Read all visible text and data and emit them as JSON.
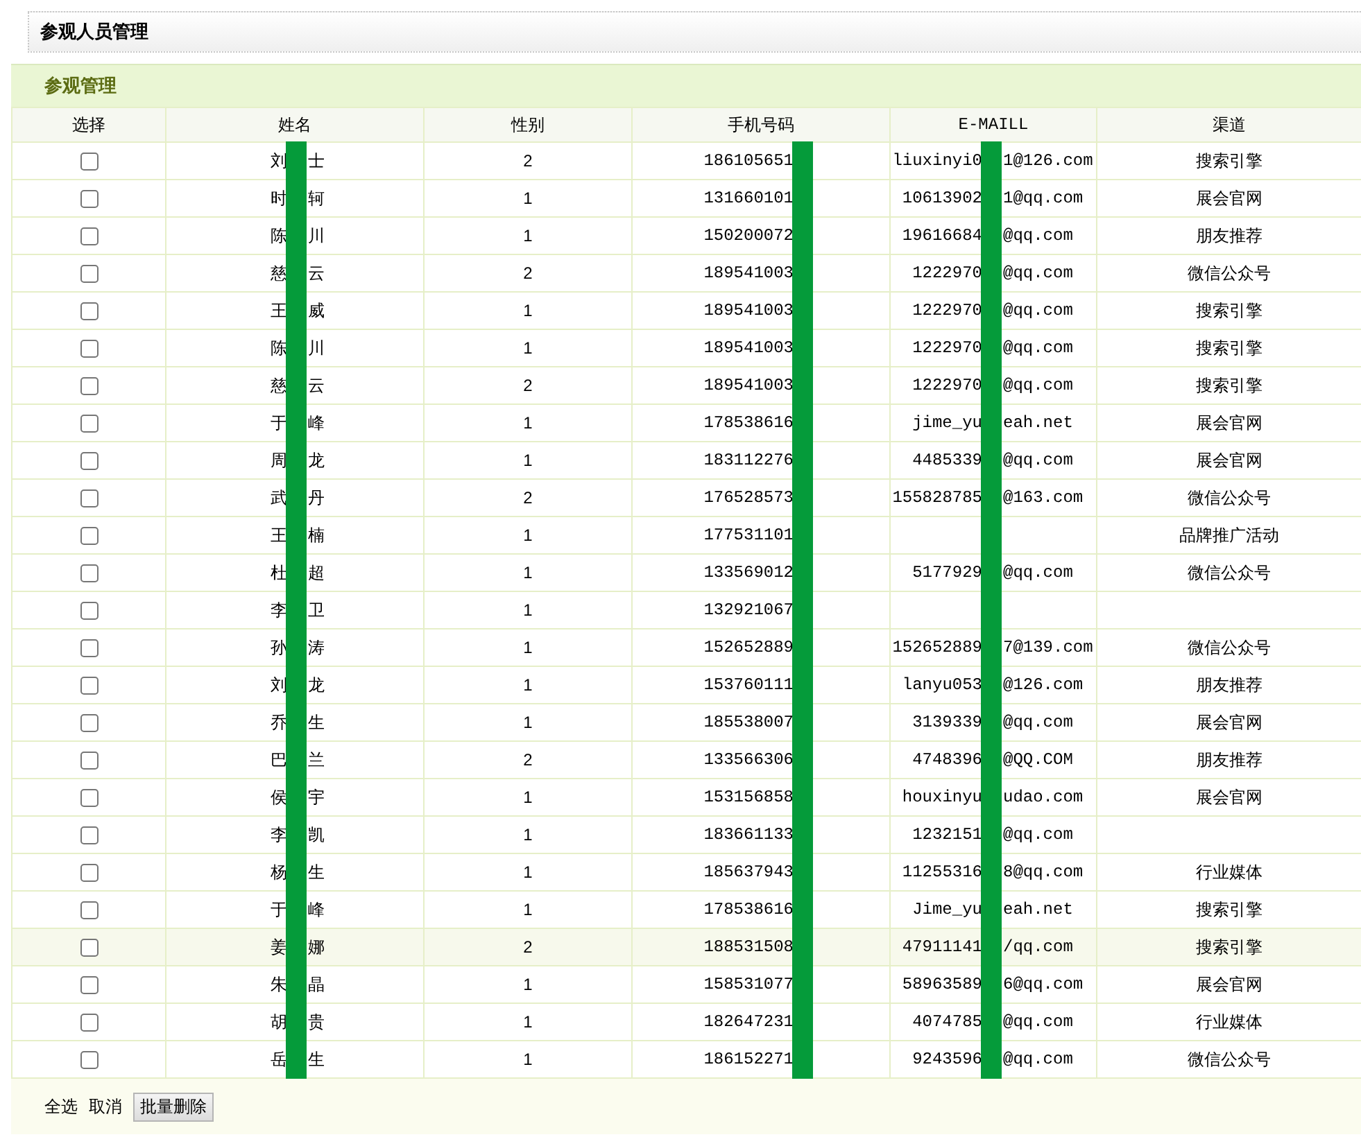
{
  "page_title": "参观人员管理",
  "panel": {
    "title": "参观管理",
    "columns": [
      "选择",
      "姓名",
      "性别",
      "手机号码",
      "E-MAILL",
      "渠道"
    ],
    "rows": [
      {
        "checked": false,
        "hovered": false,
        "name_start": "刘",
        "name_end": "士",
        "gender": "2",
        "phone": "186105651",
        "email_start": "liuxinyi0",
        "email_end": "1@126.com",
        "channel": "搜索引擎"
      },
      {
        "checked": false,
        "hovered": false,
        "name_start": "时",
        "name_end": "轲",
        "gender": "1",
        "phone": "131660101",
        "email_start": "10613902",
        "email_end": "1@qq.com",
        "channel": "展会官网"
      },
      {
        "checked": false,
        "hovered": false,
        "name_start": "陈",
        "name_end": "川",
        "gender": "1",
        "phone": "150200072",
        "email_start": "19616684",
        "email_end": "@qq.com",
        "channel": "朋友推荐"
      },
      {
        "checked": false,
        "hovered": false,
        "name_start": "慈",
        "name_end": "云",
        "gender": "2",
        "phone": "189541003",
        "email_start": "1222970",
        "email_end": "@qq.com",
        "channel": "微信公众号"
      },
      {
        "checked": false,
        "hovered": false,
        "name_start": "王",
        "name_end": "威",
        "gender": "1",
        "phone": "189541003",
        "email_start": "1222970",
        "email_end": "@qq.com",
        "channel": "搜索引擎"
      },
      {
        "checked": false,
        "hovered": false,
        "name_start": "陈",
        "name_end": "川",
        "gender": "1",
        "phone": "189541003",
        "email_start": "1222970",
        "email_end": "@qq.com",
        "channel": "搜索引擎"
      },
      {
        "checked": false,
        "hovered": false,
        "name_start": "慈",
        "name_end": "云",
        "gender": "2",
        "phone": "189541003",
        "email_start": "1222970",
        "email_end": "@qq.com",
        "channel": "搜索引擎"
      },
      {
        "checked": false,
        "hovered": false,
        "name_start": "于",
        "name_end": "峰",
        "gender": "1",
        "phone": "178538616",
        "email_start": "jime_yu",
        "email_end": "eah.net",
        "channel": "展会官网"
      },
      {
        "checked": false,
        "hovered": false,
        "name_start": "周",
        "name_end": "龙",
        "gender": "1",
        "phone": "183112276",
        "email_start": "4485339",
        "email_end": "@qq.com",
        "channel": "展会官网"
      },
      {
        "checked": false,
        "hovered": false,
        "name_start": "武",
        "name_end": "丹",
        "gender": "2",
        "phone": "176528573",
        "email_start": "155828785",
        "email_end": "@163.com",
        "channel": "微信公众号"
      },
      {
        "checked": false,
        "hovered": false,
        "name_start": "王",
        "name_end": "楠",
        "gender": "1",
        "phone": "177531101",
        "channel": "品牌推广活动"
      },
      {
        "checked": false,
        "hovered": false,
        "name_start": "杜",
        "name_end": "超",
        "gender": "1",
        "phone": "133569012",
        "email_start": "5177929",
        "email_end": "@qq.com",
        "channel": "微信公众号"
      },
      {
        "checked": false,
        "hovered": false,
        "name_start": "李",
        "name_end": "卫",
        "gender": "1",
        "phone": "132921067"
      },
      {
        "checked": false,
        "hovered": false,
        "name_start": "孙",
        "name_end": "涛",
        "gender": "1",
        "phone": "152652889",
        "email_start": "152652889",
        "email_end": "7@139.com",
        "channel": "微信公众号"
      },
      {
        "checked": false,
        "hovered": false,
        "name_start": "刘",
        "name_end": "龙",
        "gender": "1",
        "phone": "153760111",
        "email_start": "lanyu053",
        "email_end": "@126.com",
        "channel": "朋友推荐"
      },
      {
        "checked": false,
        "hovered": false,
        "name_start": "乔",
        "name_end": "生",
        "gender": "1",
        "phone": "185538007",
        "email_start": "3139339",
        "email_end": "@qq.com",
        "channel": "展会官网"
      },
      {
        "checked": false,
        "hovered": false,
        "name_start": "巴",
        "name_end": "兰",
        "gender": "2",
        "phone": "133566306",
        "email_start": "4748396",
        "email_end": "@QQ.COM",
        "channel": "朋友推荐"
      },
      {
        "checked": false,
        "hovered": false,
        "name_start": "侯",
        "name_end": "宇",
        "gender": "1",
        "phone": "153156858",
        "email_start": "houxinyu",
        "email_end": "udao.com",
        "channel": "展会官网"
      },
      {
        "checked": false,
        "hovered": false,
        "name_start": "李",
        "name_end": "凯",
        "gender": "1",
        "phone": "183661133",
        "email_start": "1232151",
        "email_end": "@qq.com"
      },
      {
        "checked": false,
        "hovered": false,
        "name_start": "杨",
        "name_end": "生",
        "gender": "1",
        "phone": "185637943",
        "email_start": "11255316",
        "email_end": "8@qq.com",
        "channel": "行业媒体"
      },
      {
        "checked": false,
        "hovered": false,
        "name_start": "于",
        "name_end": "峰",
        "gender": "1",
        "phone": "178538616",
        "email_start": "Jime_yu",
        "email_end": "eah.net",
        "channel": "搜索引擎"
      },
      {
        "checked": false,
        "hovered": true,
        "name_start": "姜",
        "name_end": "娜",
        "gender": "2",
        "phone": "188531508",
        "email_start": "47911141",
        "email_end": "/qq.com",
        "channel": "搜索引擎"
      },
      {
        "checked": false,
        "hovered": false,
        "name_start": "朱",
        "name_end": "晶",
        "gender": "1",
        "phone": "158531077",
        "email_start": "58963589",
        "email_end": "6@qq.com",
        "channel": "展会官网"
      },
      {
        "checked": false,
        "hovered": false,
        "name_start": "胡",
        "name_end": "贵",
        "gender": "1",
        "phone": "182647231",
        "email_start": "4074785",
        "email_end": "@qq.com",
        "channel": "行业媒体"
      },
      {
        "checked": false,
        "hovered": false,
        "name_start": "岳",
        "name_end": "生",
        "gender": "1",
        "phone": "186152271",
        "email_start": "9243596",
        "email_end": "@qq.com",
        "channel": "微信公众号"
      }
    ],
    "footer": {
      "select_all": "全选",
      "cancel": "取消",
      "delete_button": "批量删除"
    }
  }
}
